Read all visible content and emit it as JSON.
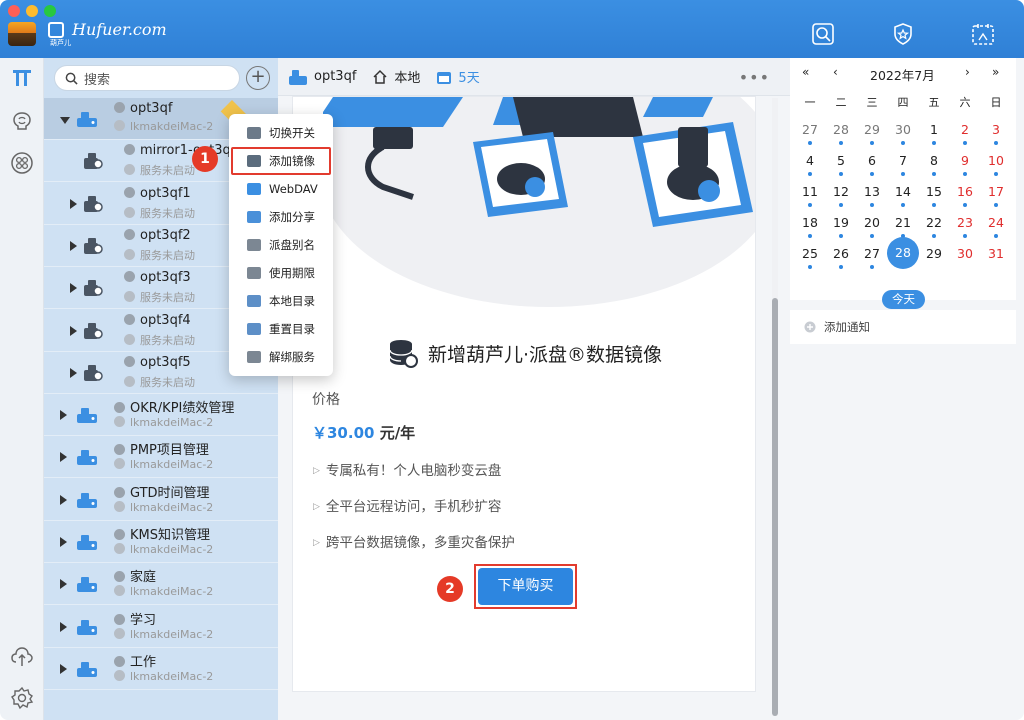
{
  "brand": {
    "sub": "葫芦儿",
    "name": "Hufuer.com"
  },
  "search": {
    "placeholder": "搜索"
  },
  "tree": [
    {
      "name": "opt3qf",
      "sub": "lkmakdeiMac-2",
      "expanded": true,
      "selected": true
    },
    {
      "name": "mirror1-opt3qf",
      "sub": "服务未启动",
      "child": true,
      "noarrow": true
    },
    {
      "name": "opt3qf1",
      "sub": "服务未启动",
      "child": true
    },
    {
      "name": "opt3qf2",
      "sub": "服务未启动",
      "child": true
    },
    {
      "name": "opt3qf3",
      "sub": "服务未启动",
      "child": true
    },
    {
      "name": "opt3qf4",
      "sub": "服务未启动",
      "child": true
    },
    {
      "name": "opt3qf5",
      "sub": "服务未启动",
      "child": true
    },
    {
      "name": "OKR/KPI绩效管理",
      "sub": "lkmakdeiMac-2"
    },
    {
      "name": "PMP项目管理",
      "sub": "lkmakdeiMac-2"
    },
    {
      "name": "GTD时间管理",
      "sub": "lkmakdeiMac-2"
    },
    {
      "name": "KMS知识管理",
      "sub": "lkmakdeiMac-2"
    },
    {
      "name": "家庭",
      "sub": "lkmakdeiMac-2"
    },
    {
      "name": "学习",
      "sub": "lkmakdeiMac-2"
    },
    {
      "name": "工作",
      "sub": "lkmakdeiMac-2"
    }
  ],
  "context_menu": [
    {
      "label": "切换开关",
      "color": "#6c7a89"
    },
    {
      "label": "添加镜像",
      "color": "#5b6c7d",
      "highlight": true
    },
    {
      "label": "WebDAV",
      "color": "#3b8fe2"
    },
    {
      "label": "添加分享",
      "color": "#4a90d9"
    },
    {
      "label": "派盘别名",
      "color": "#7c8793"
    },
    {
      "label": "使用期限",
      "color": "#7c8793"
    },
    {
      "label": "本地目录",
      "color": "#5d8fc7"
    },
    {
      "label": "重置目录",
      "color": "#5d8fc7"
    },
    {
      "label": "解绑服务",
      "color": "#7c8793"
    }
  ],
  "badges": {
    "one": "1",
    "two": "2"
  },
  "main_top": {
    "item1": "opt3qf",
    "item2": "本地",
    "item3": "5天"
  },
  "product": {
    "title": "新增葫芦儿·派盘®数据镜像",
    "price_label": "价格",
    "price": "￥30.00",
    "price_unit": "元/年",
    "features": [
      "专属私有！个人电脑秒变云盘",
      "全平台远程访问，手机秒扩容",
      "跨平台数据镜像，多重灾备保护"
    ],
    "buy_label": "下单购买"
  },
  "calendar": {
    "nav": [
      "«",
      "‹",
      "2022年7月",
      "›",
      "»"
    ],
    "weekdays": [
      "一",
      "二",
      "三",
      "四",
      "五",
      "六",
      "日"
    ],
    "weeks": [
      [
        "27",
        "28",
        "29",
        "30",
        "1",
        "2",
        "3"
      ],
      [
        "4",
        "5",
        "6",
        "7",
        "8",
        "9",
        "10"
      ],
      [
        "11",
        "12",
        "13",
        "14",
        "15",
        "16",
        "17"
      ],
      [
        "18",
        "19",
        "20",
        "21",
        "22",
        "23",
        "24"
      ],
      [
        "25",
        "26",
        "27",
        "28",
        "29",
        "30",
        "31"
      ]
    ],
    "today_day": "28",
    "today_label": "今天",
    "weekend_color": "#e02d2d",
    "accent": "#2d86e0"
  },
  "notice": {
    "label": "添加通知"
  }
}
